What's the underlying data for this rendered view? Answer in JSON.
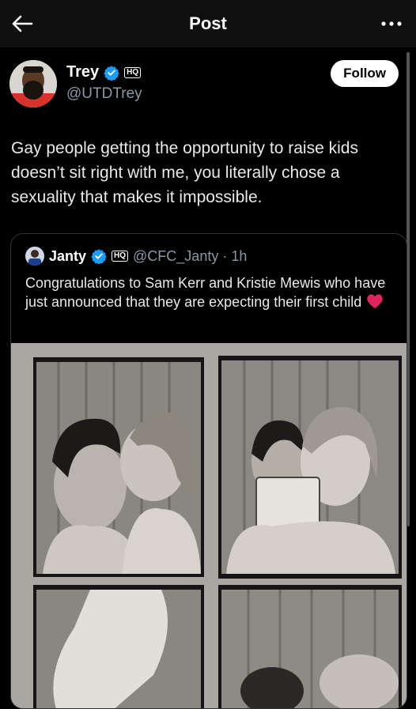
{
  "header": {
    "title": "Post",
    "back_icon": "arrow-left-icon",
    "more_icon": "ellipsis-icon"
  },
  "post": {
    "author_name": "Trey",
    "author_handle": "@UTDTrey",
    "badge": "HQ",
    "follow_label": "Follow",
    "text": "Gay people getting the opportunity to raise kids doesn’t sit right with me, you literally chose a sexuality that makes it impossible."
  },
  "quote": {
    "author_name": "Janty",
    "badge": "HQ",
    "handle_time": "@CFC_Janty · 1h",
    "text": "Congratulations to Sam Kerr and Kristie Mewis who have just announced that they are expecting their first child"
  },
  "colors": {
    "background": "#000000",
    "verified": "#1d9bf0",
    "secondary_text": "#8b98a5",
    "heart": "#e0245e"
  }
}
